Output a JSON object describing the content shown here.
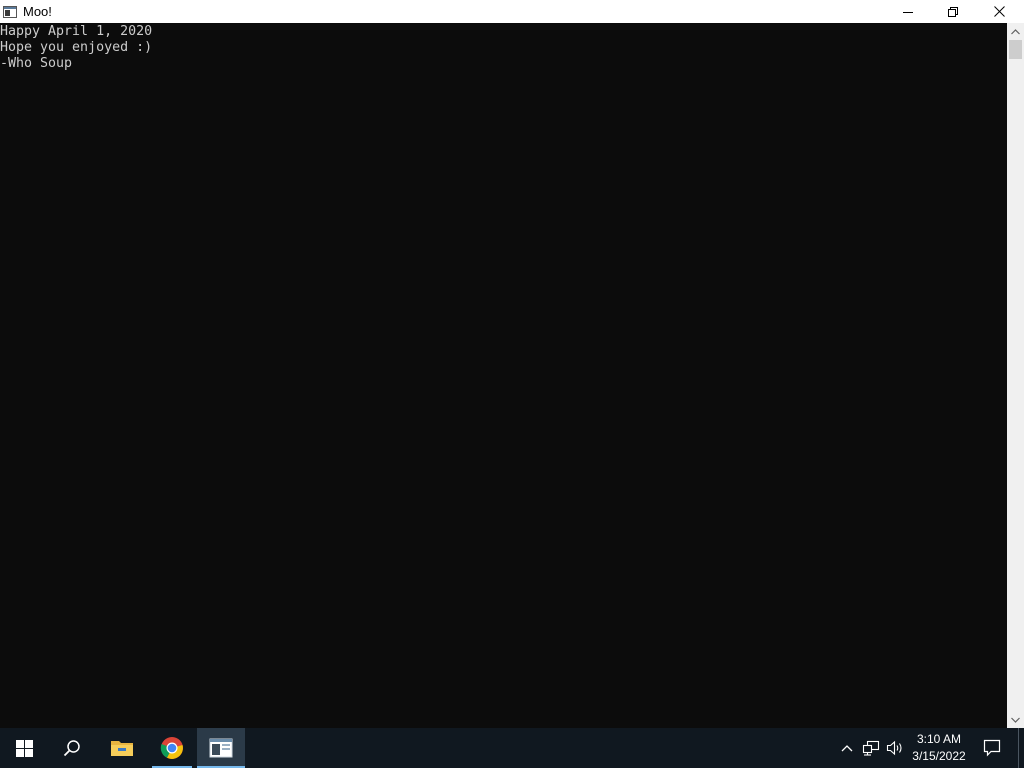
{
  "window": {
    "title": "Moo!"
  },
  "console": {
    "lines": [
      "Happy April 1, 2020",
      "Hope you enjoyed :)",
      "-Who Soup"
    ],
    "background": "#0c0c0c",
    "text_color": "#cccccc"
  },
  "taskbar": {
    "items": [
      {
        "name": "start",
        "icon": "windows-logo-icon"
      },
      {
        "name": "search",
        "icon": "search-icon"
      },
      {
        "name": "file-explorer",
        "icon": "folder-icon"
      },
      {
        "name": "chrome",
        "icon": "chrome-icon"
      },
      {
        "name": "console-app",
        "icon": "console-window-icon",
        "active": true
      }
    ],
    "tray": {
      "icons": [
        "chevron-up-icon",
        "network-icon",
        "volume-icon"
      ],
      "time": "3:10 AM",
      "date": "3/15/2022"
    },
    "background": "#101820",
    "accent": "#76b9ed"
  }
}
